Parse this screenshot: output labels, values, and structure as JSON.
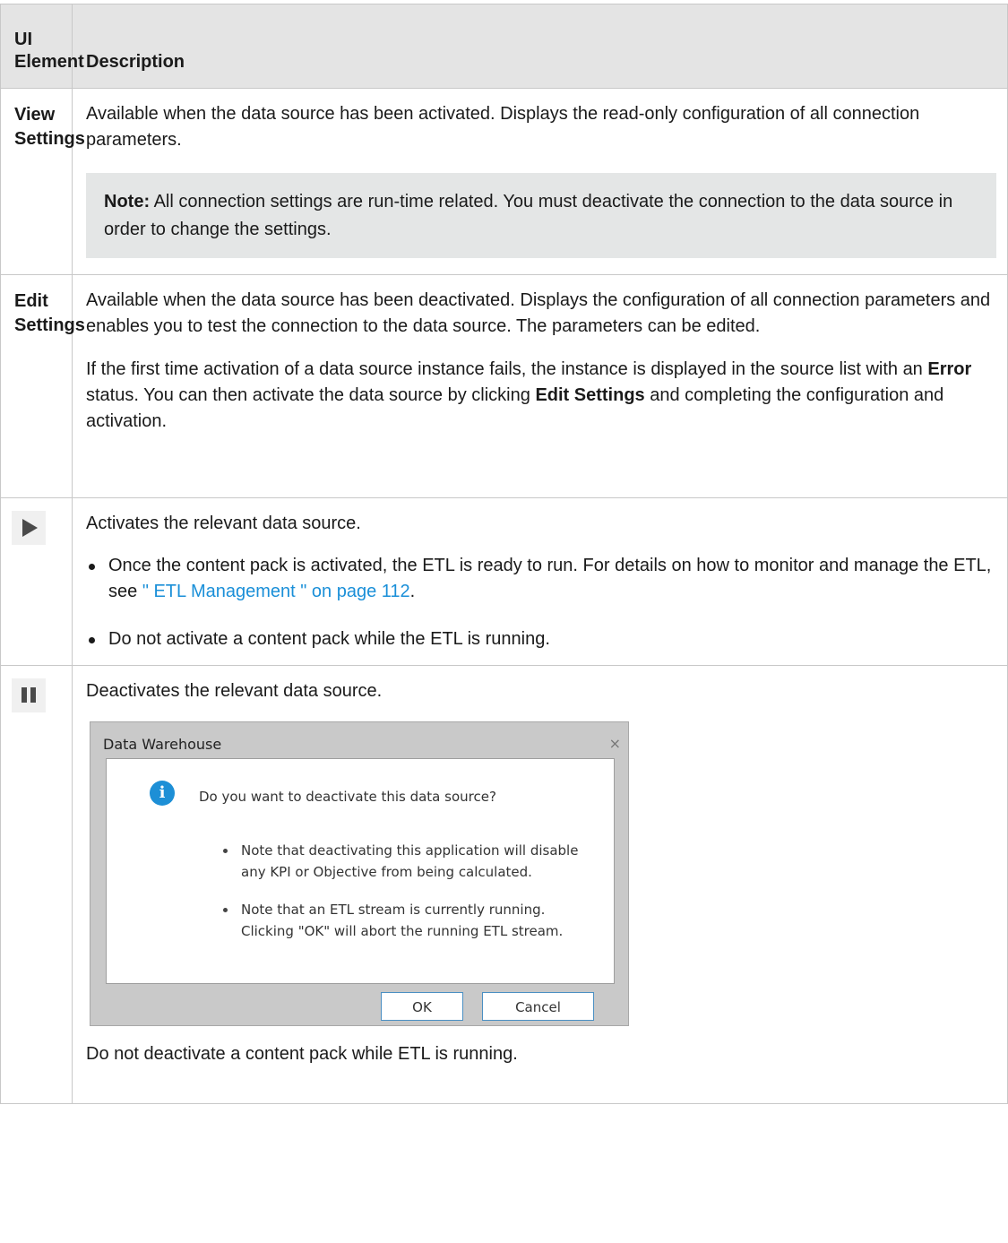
{
  "header": {
    "col1": "UI Element",
    "col2": "Description"
  },
  "rows": {
    "view": {
      "element": "View Settings",
      "text": "Available when the data source has been activated. Displays the read-only configuration of all connection parameters.",
      "note_label": "Note:",
      "note_text": " All connection settings are run-time related. You must deactivate the connection to the data source in order to change the settings."
    },
    "edit": {
      "element": "Edit Settings",
      "text": "Available when the data source has been deactivated. Displays the configuration of all connection parameters and enables you to test the connection to the data source. The parameters can be edited.",
      "p2_a": "If the first time activation of a data source instance fails, the instance is displayed in the source list with an ",
      "p2_bold1": "Error",
      "p2_b": " status. You can then activate the data source by clicking ",
      "p2_bold2": "Edit Settings",
      "p2_c": " and completing the configuration and activation."
    },
    "activate": {
      "icon": "play-icon",
      "text": "Activates the relevant data source.",
      "bullet1_a": "Once the content pack is activated, the ETL is ready to run. For details on how to monitor and manage the ETL, see ",
      "bullet1_link": "\" ETL Management \" on page 112",
      "bullet1_b": ".",
      "bullet2": "Do not activate a content pack while the ETL is running."
    },
    "deactivate": {
      "icon": "pause-icon",
      "text": "Deactivates the relevant data source.",
      "dialog": {
        "title": "Data Warehouse",
        "close": "×",
        "question": "Do you want to deactivate this data source?",
        "items": [
          "Note that deactivating this application will disable any KPI or Objective from being calculated.",
          "Note that an ETL stream is currently running. Clicking \"OK\" will abort the running ETL stream."
        ],
        "ok": "OK",
        "cancel": "Cancel"
      },
      "footer": "Do not deactivate a content pack while ETL is running."
    }
  },
  "colors": {
    "header_bg": "#e4e4e4",
    "note_bg": "#e4e6e6",
    "link": "#1a8fd8",
    "info": "#1d8fd6"
  }
}
